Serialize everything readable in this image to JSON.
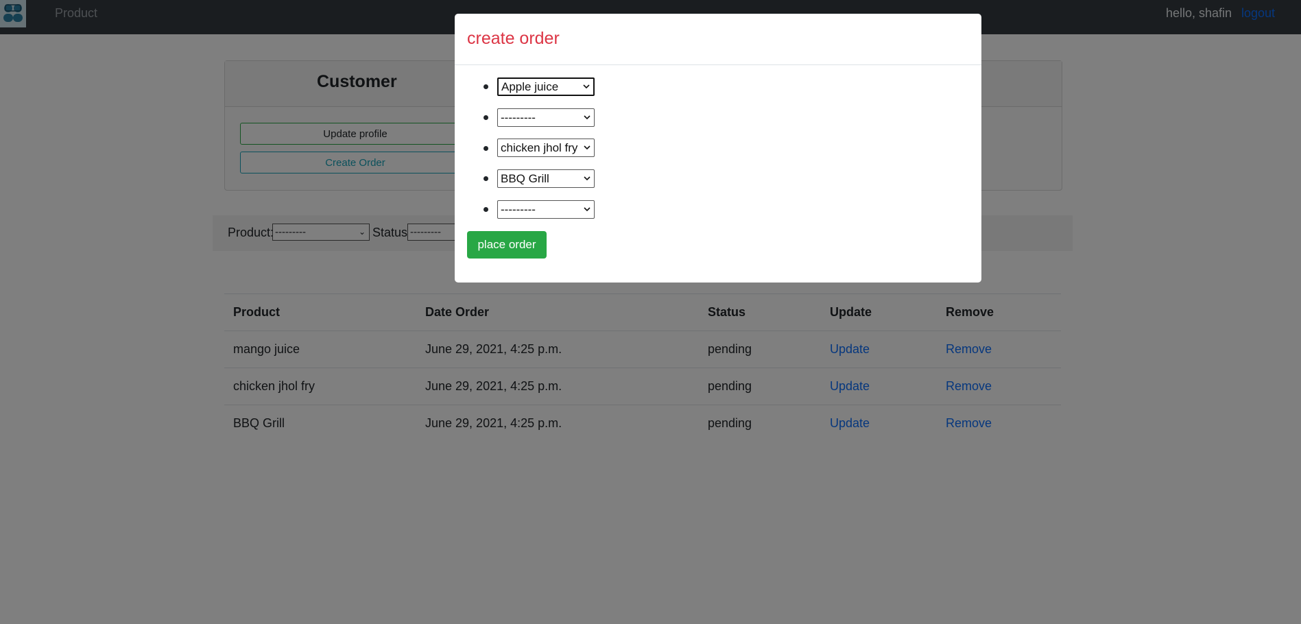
{
  "nav": {
    "logo_icon": "users-logo-icon",
    "product_link": "Product",
    "greeting": "hello, shafin",
    "logout": "logout"
  },
  "card": {
    "title": "Customer",
    "update_profile": "Update profile",
    "create_order": "Create Order"
  },
  "filter": {
    "product_label": "Product:",
    "product_value": "---------",
    "status_label": "Status:",
    "status_value": "---------"
  },
  "table": {
    "headers": [
      "Product",
      "Date Order",
      "Status",
      "Update",
      "Remove"
    ],
    "rows": [
      {
        "product": "mango juice",
        "date": "June 29, 2021, 4:25 p.m.",
        "status": "pending",
        "update": "Update",
        "remove": "Remove"
      },
      {
        "product": "chicken jhol fry",
        "date": "June 29, 2021, 4:25 p.m.",
        "status": "pending",
        "update": "Update",
        "remove": "Remove"
      },
      {
        "product": "BBQ Grill",
        "date": "June 29, 2021, 4:25 p.m.",
        "status": "pending",
        "update": "Update",
        "remove": "Remove"
      }
    ]
  },
  "modal": {
    "title": "create order",
    "selects": [
      "Apple juice",
      "---------",
      "chicken jhol fry",
      "BBQ Grill",
      "---------"
    ],
    "submit": "place order"
  },
  "colors": {
    "navbar": "#343a40",
    "link": "#0d6efd",
    "danger": "#dc3545",
    "success": "#28a745",
    "info": "#17a2b8"
  }
}
